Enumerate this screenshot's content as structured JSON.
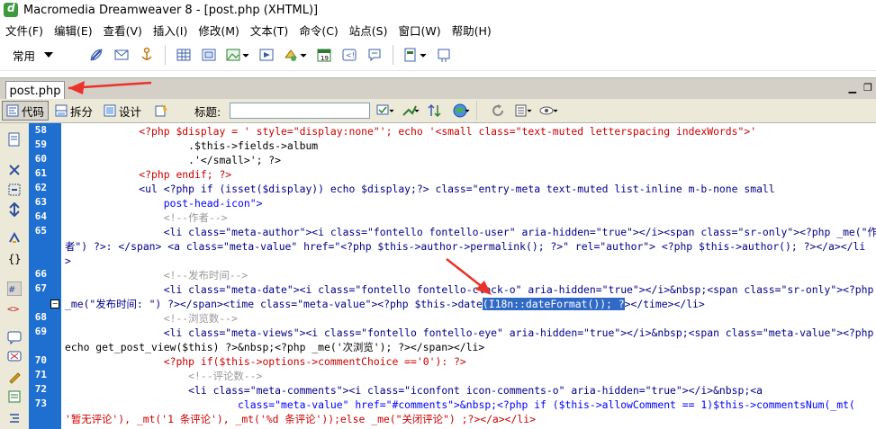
{
  "window": {
    "title": "Macromedia Dreamweaver 8 - [post.php (XHTML)]"
  },
  "menubar": {
    "items": [
      "文件(F)",
      "编辑(E)",
      "查看(V)",
      "插入(I)",
      "修改(M)",
      "文本(T)",
      "命令(C)",
      "站点(S)",
      "窗口(W)",
      "帮助(H)"
    ]
  },
  "insert_toolbar": {
    "category": "常用"
  },
  "document": {
    "tab_label": "post.php"
  },
  "doc_toolbar": {
    "code_label": "代码",
    "split_label": "拆分",
    "design_label": "设计",
    "title_label": "标题:",
    "title_value": ""
  },
  "colors": {
    "gutter": "#1f6fd0",
    "selection": "#3169c6",
    "arrow": "#e8322a"
  },
  "editor": {
    "line_numbers": [
      "58",
      "59",
      "60",
      "61",
      "62",
      "63",
      "64",
      "65",
      "66",
      "67",
      "68",
      "69",
      "70",
      "71",
      "72",
      "73"
    ],
    "rows": [
      "            <?php $display = ' style=\"display:none\"'; echo '<small class=\"text-muted letterspacing indexWords\">'",
      "                    .$this->fields->album",
      "                    .'</small>'; ?>",
      "            <?php endif; ?>",
      "            <ul <?php if (isset($display)) echo $display;?> class=\"entry-meta text-muted list-inline m-b-none small",
      "                post-head-icon\">",
      "                <!--作者-->",
      "                <li class=\"meta-author\"><i class=\"fontello fontello-user\" aria-hidden=\"true\"></i><span class=\"sr-only\"><?php _me(\"作",
      "者\") ?>: </span> <a class=\"meta-value\" href=\"<?php $this->author->permalink(); ?>\" rel=\"author\"> <?php $this->author(); ?></a></li",
      ">",
      "                <!--发布时间-->",
      "                <li class=\"meta-date\"><i class=\"fontello fontello-clock-o\" aria-hidden=\"true\"></i>&nbsp;<span class=\"sr-only\"><?php",
      "_me(\"发布时间: \") ?></span><time class=\"meta-value\"><?php $this->date",
      "(I18n::dateFormat()); ?",
      "></time></li>",
      "                <!--浏览数-->",
      "                <li class=\"meta-views\"><i class=\"fontello fontello-eye\" aria-hidden=\"true\"></i>&nbsp;<span class=\"meta-value\"><?php",
      "echo get_post_view($this) ?>&nbsp;<?php _me('次浏览'); ?></span></li>",
      "                <?php if($this->options->commentChoice =='0'): ?>",
      "                    <!--评论数-->",
      "                    <li class=\"meta-comments\"><i class=\"iconfont icon-comments-o\" aria-hidden=\"true\"></i>&nbsp;<a",
      "                            class=\"meta-value\" href=\"#comments\">&nbsp;<?php if ($this->allowComment == 1)$this->commentsNum(_mt(",
      "'暂无评论'), _mt('1 条评论'), _mt('%d 条评论'));else _me(\"关闭评论\") ;?></a></li>"
    ]
  }
}
